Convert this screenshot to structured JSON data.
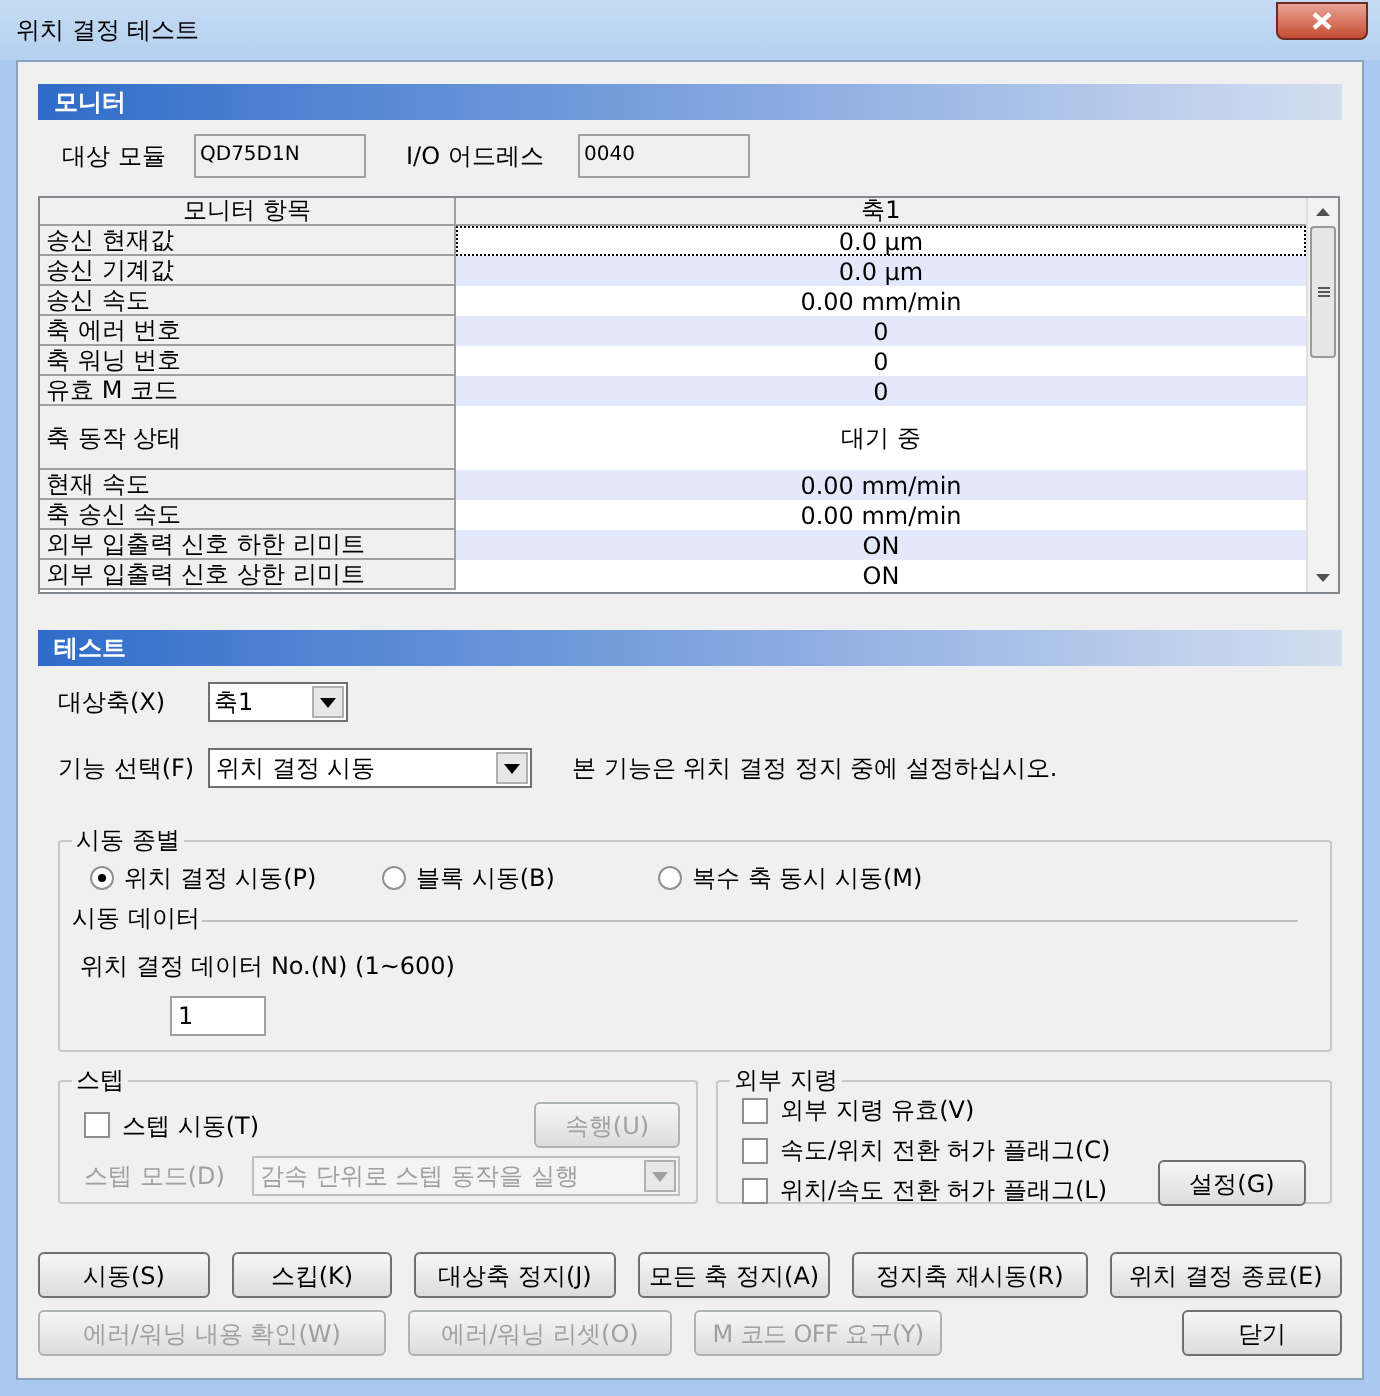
{
  "window": {
    "title": "위치 결정 테스트"
  },
  "monitor": {
    "header": "모니터",
    "fields": [
      {
        "label": "대상 모듈",
        "value": "QD75D1N"
      },
      {
        "label": "I/O 어드레스",
        "value": "0040"
      }
    ],
    "table": {
      "columns": [
        "모니터 항목",
        "축1"
      ],
      "rows": [
        {
          "item": "송신 현재값",
          "value": "0.0 µm",
          "selected": true
        },
        {
          "item": "송신 기계값",
          "value": "0.0 µm",
          "selected": false
        },
        {
          "item": "송신 속도",
          "value": "0.00 mm/min",
          "selected": false
        },
        {
          "item": "축 에러 번호",
          "value": "0",
          "selected": false
        },
        {
          "item": "축 워닝 번호",
          "value": "0",
          "selected": false
        },
        {
          "item": "유효 M 코드",
          "value": "0",
          "selected": false
        },
        {
          "item": "축 동작 상태",
          "value": "대기 중",
          "selected": false,
          "kind": "tall"
        },
        {
          "item": "현재 속도",
          "value": "0.00 mm/min",
          "selected": false
        },
        {
          "item": "축 송신 속도",
          "value": "0.00 mm/min",
          "selected": false
        },
        {
          "item": "외부 입출력 신호 하한 리미트",
          "value": "ON",
          "selected": false
        },
        {
          "item": "외부 입출력 신호 상한 리미트",
          "value": "ON",
          "selected": false
        }
      ]
    }
  },
  "test": {
    "header": "테스트",
    "axis": {
      "label": "대상축(X)",
      "value": "축1"
    },
    "function": {
      "label": "기능 선택(F)",
      "value": "위치 결정 시동",
      "note": "본 기능은 위치 결정 정지 중에 설정하십시오."
    },
    "start_type": {
      "legend": "시동 종별",
      "options": [
        {
          "label": "위치 결정 시동(P)",
          "selected": true
        },
        {
          "label": "블록 시동(B)",
          "selected": false
        },
        {
          "label": "복수 축 동시 시동(M)",
          "selected": false
        }
      ],
      "data": {
        "legend": "시동 데이터",
        "label": "위치 결정 데이터 No.(N) (1~600)",
        "value": "1"
      }
    },
    "step": {
      "legend": "스텝",
      "checkbox": {
        "label": "스텝 시동(T)",
        "checked": false
      },
      "button": {
        "label": "속행(U)",
        "disabled": true
      },
      "mode": {
        "label": "스텝 모드(D)",
        "value": "감속 단위로 스텝 동작을 실행",
        "disabled": true
      }
    },
    "external": {
      "legend": "외부 지령",
      "checkboxes": [
        {
          "label": "외부 지령 유효(V)",
          "checked": false
        },
        {
          "label": "속도/위치 전환 허가 플래그(C)",
          "checked": false
        },
        {
          "label": "위치/속도 전환 허가 플래그(L)",
          "checked": false
        }
      ],
      "button": {
        "label": "설정(G)",
        "disabled": false
      }
    }
  },
  "button_rows": [
    {
      "buttons": [
        {
          "label": "시동(S)",
          "disabled": false
        },
        {
          "label": "스킵(K)",
          "disabled": false
        },
        {
          "label": "대상축 정지(J)",
          "disabled": false
        },
        {
          "label": "모든 축 정지(A)",
          "disabled": false
        },
        {
          "label": "정지축 재시동(R)",
          "disabled": false
        },
        {
          "label": "위치 결정 종료(E)",
          "disabled": false
        }
      ]
    },
    {
      "buttons": [
        {
          "label": "에러/워닝 내용 확인(W)",
          "disabled": true
        },
        {
          "label": "에러/워닝 리셋(O)",
          "disabled": true
        },
        {
          "label": "M 코드 OFF 요구(Y)",
          "disabled": true
        },
        {
          "label": "닫기",
          "disabled": false
        }
      ]
    }
  ]
}
